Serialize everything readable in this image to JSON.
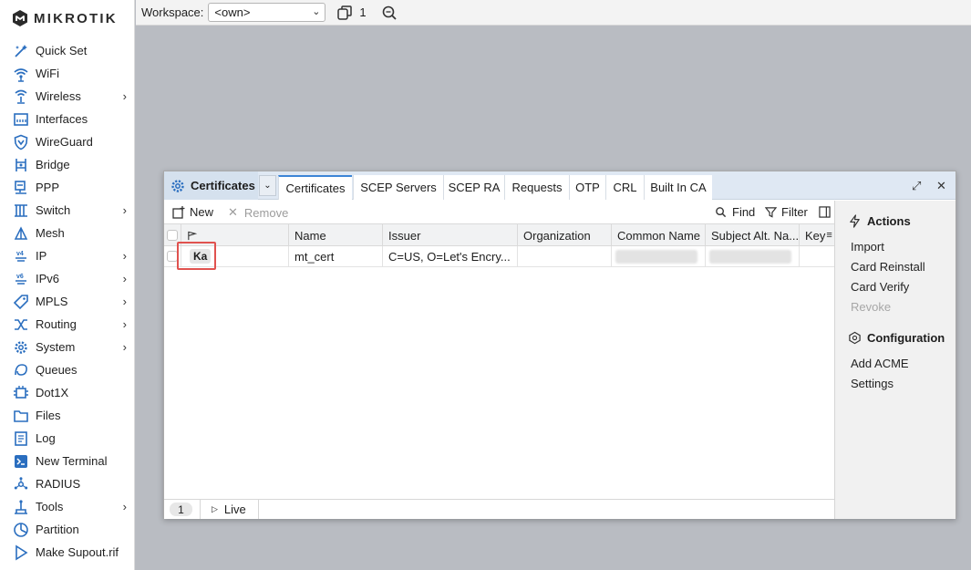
{
  "brand": {
    "name": "MikroTik",
    "logo_text": "MIKROTIK"
  },
  "sidebar": {
    "items": [
      {
        "label": "Quick Set",
        "icon": "wand-icon",
        "has_submenu": false
      },
      {
        "label": "WiFi",
        "icon": "wifi-icon",
        "has_submenu": false
      },
      {
        "label": "Wireless",
        "icon": "wireless-icon",
        "has_submenu": true
      },
      {
        "label": "Interfaces",
        "icon": "interfaces-icon",
        "has_submenu": false
      },
      {
        "label": "WireGuard",
        "icon": "shield-icon",
        "has_submenu": false
      },
      {
        "label": "Bridge",
        "icon": "bridge-icon",
        "has_submenu": false
      },
      {
        "label": "PPP",
        "icon": "ppp-icon",
        "has_submenu": false
      },
      {
        "label": "Switch",
        "icon": "switch-icon",
        "has_submenu": true
      },
      {
        "label": "Mesh",
        "icon": "mesh-icon",
        "has_submenu": false
      },
      {
        "label": "IP",
        "icon": "ip-icon",
        "has_submenu": true
      },
      {
        "label": "IPv6",
        "icon": "ipv6-icon",
        "has_submenu": true
      },
      {
        "label": "MPLS",
        "icon": "mpls-icon",
        "has_submenu": true
      },
      {
        "label": "Routing",
        "icon": "routing-icon",
        "has_submenu": true
      },
      {
        "label": "System",
        "icon": "gear-icon",
        "has_submenu": true
      },
      {
        "label": "Queues",
        "icon": "queues-icon",
        "has_submenu": false
      },
      {
        "label": "Dot1X",
        "icon": "dot1x-icon",
        "has_submenu": false
      },
      {
        "label": "Files",
        "icon": "folder-icon",
        "has_submenu": false
      },
      {
        "label": "Log",
        "icon": "log-icon",
        "has_submenu": false
      },
      {
        "label": "New Terminal",
        "icon": "terminal-icon",
        "has_submenu": false
      },
      {
        "label": "RADIUS",
        "icon": "radius-icon",
        "has_submenu": false
      },
      {
        "label": "Tools",
        "icon": "tools-icon",
        "has_submenu": true
      },
      {
        "label": "Partition",
        "icon": "partition-icon",
        "has_submenu": false
      },
      {
        "label": "Make Supout.rif",
        "icon": "supout-icon",
        "has_submenu": false
      }
    ]
  },
  "topbar": {
    "workspace_label": "Workspace:",
    "workspace_value": "<own>",
    "window_count": "1"
  },
  "window": {
    "title": "Certificates",
    "tabs": [
      "Certificates",
      "SCEP Servers",
      "SCEP RA",
      "Requests",
      "OTP",
      "CRL",
      "Built In CA"
    ],
    "active_tab": "Certificates",
    "toolbar": {
      "new_label": "New",
      "remove_label": "Remove",
      "find_label": "Find",
      "filter_label": "Filter"
    },
    "columns": [
      "Name",
      "Issuer",
      "Organization",
      "Common Name",
      "Subject Alt. Na...",
      "Key"
    ],
    "rows": [
      {
        "flags": "Ka",
        "name": "mt_cert",
        "issuer": "C=US, O=Let's Encry...",
        "organization": "",
        "common_name": "",
        "subject_alt_name": "",
        "key": ""
      }
    ],
    "status": {
      "count": "1",
      "live_label": "Live"
    },
    "actions_panel": {
      "actions_title": "Actions",
      "actions": [
        {
          "label": "Import",
          "enabled": true
        },
        {
          "label": "Card Reinstall",
          "enabled": true
        },
        {
          "label": "Card Verify",
          "enabled": true
        },
        {
          "label": "Revoke",
          "enabled": false
        }
      ],
      "configuration_title": "Configuration",
      "configuration": [
        {
          "label": "Add ACME",
          "enabled": true
        },
        {
          "label": "Settings",
          "enabled": true
        }
      ]
    }
  },
  "colors": {
    "accent": "#3c84d6",
    "icon_blue": "#2a6ebf",
    "highlight_red": "#e0524f",
    "desktop_bg": "#b9bcc2"
  }
}
